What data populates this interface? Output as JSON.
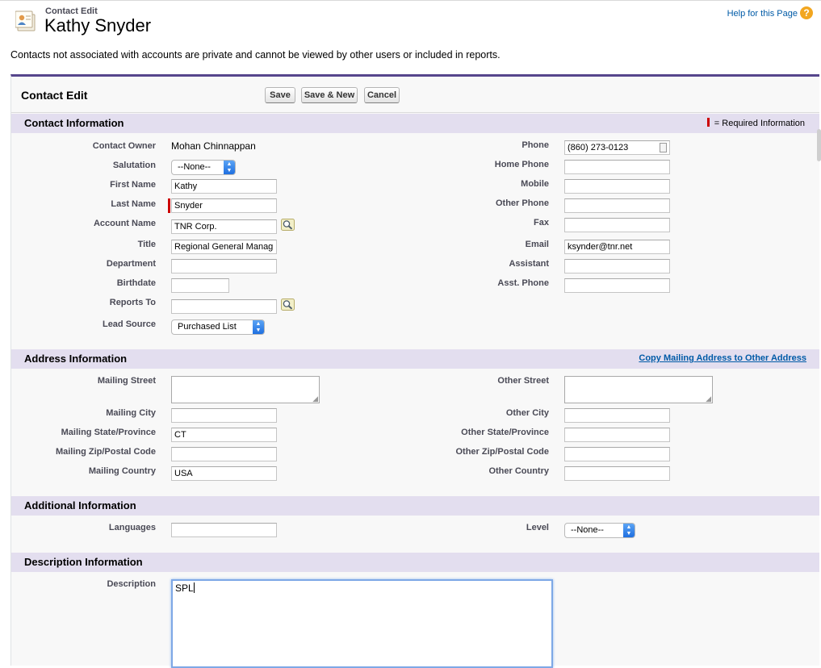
{
  "header": {
    "subtitle": "Contact Edit",
    "title": "Kathy Snyder",
    "help_link": "Help for this Page",
    "help_icon": "?",
    "notice": "Contacts not associated with accounts are private and cannot be viewed by other users or included in reports."
  },
  "page_block": {
    "title": "Contact Edit",
    "buttons": {
      "save": "Save",
      "save_new": "Save & New",
      "cancel": "Cancel"
    }
  },
  "contact_info": {
    "title": "Contact Information",
    "required_key": "= Required Information",
    "contact_owner": {
      "label": "Contact Owner",
      "value": "Mohan Chinnappan"
    },
    "salutation": {
      "label": "Salutation",
      "value": "--None--"
    },
    "first_name": {
      "label": "First Name",
      "value": "Kathy"
    },
    "last_name": {
      "label": "Last Name",
      "value": "Snyder"
    },
    "account_name": {
      "label": "Account Name",
      "value": "TNR Corp."
    },
    "title_field": {
      "label": "Title",
      "value": "Regional General Manag"
    },
    "department": {
      "label": "Department",
      "value": ""
    },
    "birthdate": {
      "label": "Birthdate",
      "value": ""
    },
    "reports_to": {
      "label": "Reports To",
      "value": ""
    },
    "lead_source": {
      "label": "Lead Source",
      "value": "Purchased List"
    },
    "phone": {
      "label": "Phone",
      "value": "(860) 273-0123"
    },
    "home_phone": {
      "label": "Home Phone",
      "value": ""
    },
    "mobile": {
      "label": "Mobile",
      "value": ""
    },
    "other_phone": {
      "label": "Other Phone",
      "value": ""
    },
    "fax": {
      "label": "Fax",
      "value": ""
    },
    "email": {
      "label": "Email",
      "value": "ksynder@tnr.net"
    },
    "assistant": {
      "label": "Assistant",
      "value": ""
    },
    "asst_phone": {
      "label": "Asst. Phone",
      "value": ""
    }
  },
  "address_info": {
    "title": "Address Information",
    "copy_link": "Copy Mailing Address to Other Address",
    "mailing_street": {
      "label": "Mailing Street",
      "value": ""
    },
    "mailing_city": {
      "label": "Mailing City",
      "value": ""
    },
    "mailing_state": {
      "label": "Mailing State/Province",
      "value": "CT"
    },
    "mailing_zip": {
      "label": "Mailing Zip/Postal Code",
      "value": ""
    },
    "mailing_country": {
      "label": "Mailing Country",
      "value": "USA"
    },
    "other_street": {
      "label": "Other Street",
      "value": ""
    },
    "other_city": {
      "label": "Other City",
      "value": ""
    },
    "other_state": {
      "label": "Other State/Province",
      "value": ""
    },
    "other_zip": {
      "label": "Other Zip/Postal Code",
      "value": ""
    },
    "other_country": {
      "label": "Other Country",
      "value": ""
    }
  },
  "additional_info": {
    "title": "Additional Information",
    "languages": {
      "label": "Languages",
      "value": ""
    },
    "level": {
      "label": "Level",
      "value": "--None--"
    }
  },
  "description_info": {
    "title": "Description Information",
    "description": {
      "label": "Description",
      "value": "SPL"
    }
  },
  "colors": {
    "accent": "#56458c",
    "section_bg": "#e3deef",
    "link": "#015ba7",
    "required": "#cc0000"
  },
  "icons": [
    "contact-card-icon",
    "help-icon",
    "lookup-icon",
    "phone-dial-icon",
    "select-arrow-icon"
  ]
}
